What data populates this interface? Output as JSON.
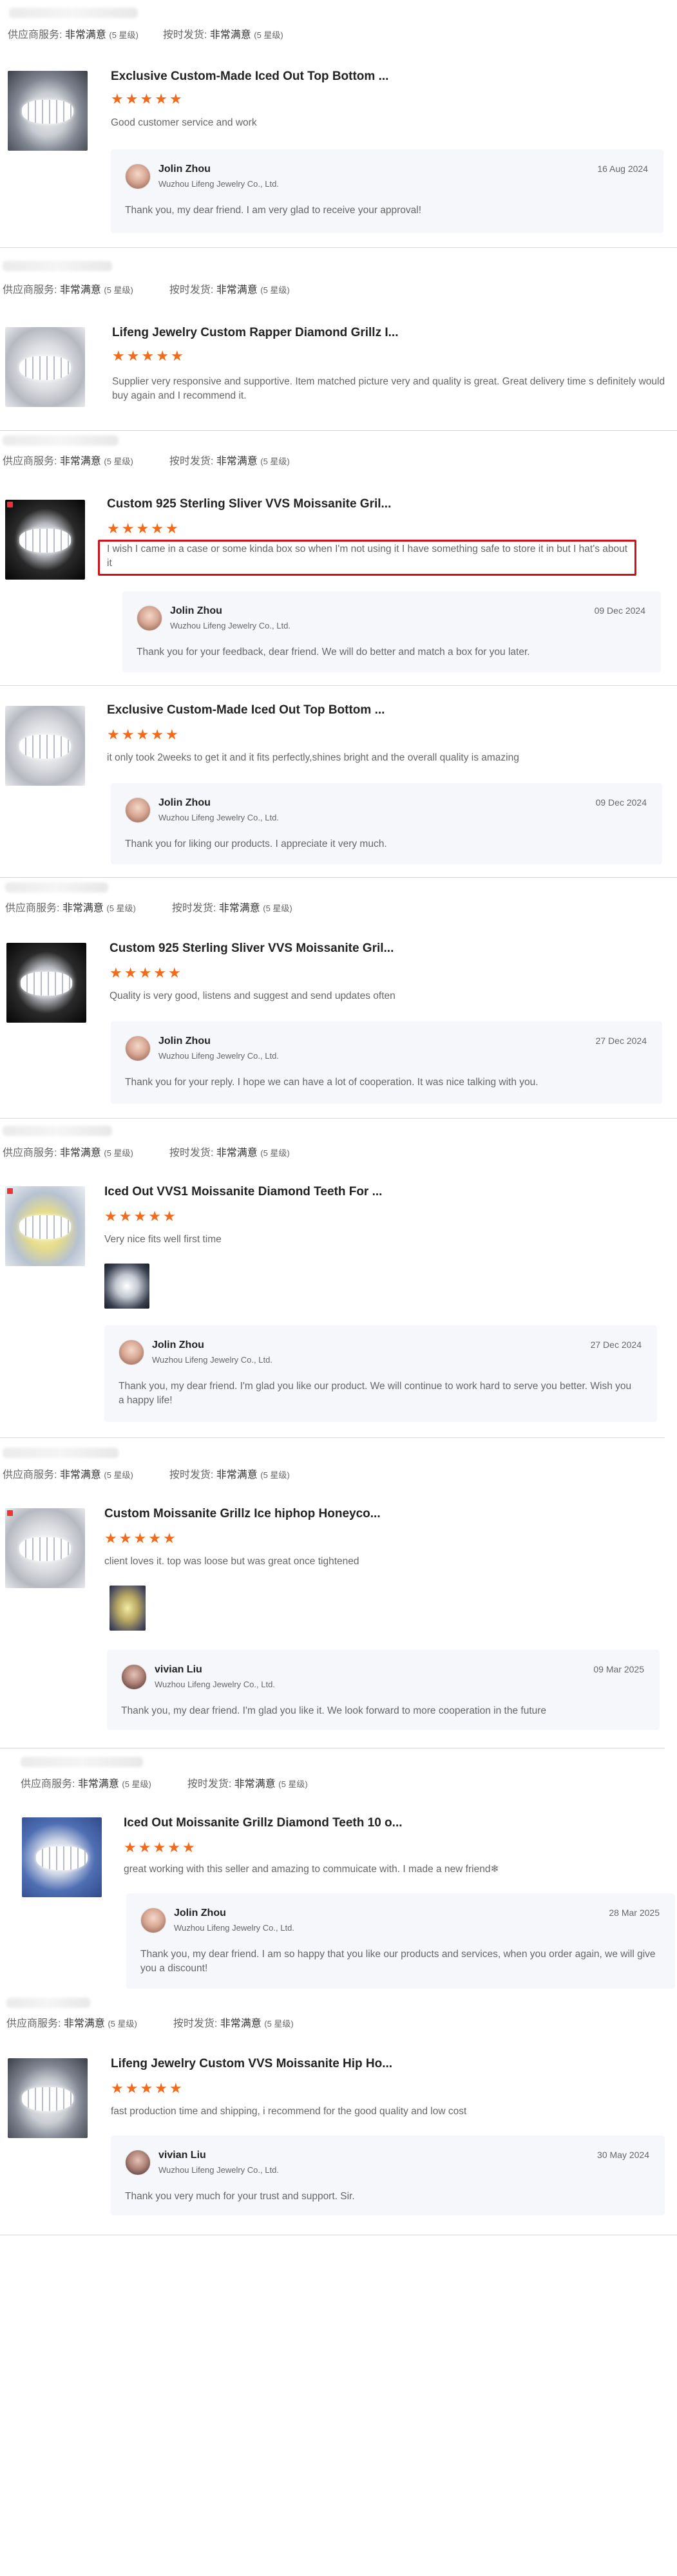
{
  "labels": {
    "supplier_service": "供应商服务:",
    "on_time": "按时发货:",
    "very_satisfied": "非常满意",
    "stars_count": "(5 星级)",
    "star_glyph": "★"
  },
  "reviews": [
    {
      "product_title": "Exclusive Custom-Made Iced Out Top Bottom ...",
      "rating": 5,
      "comment": "Good customer service and work",
      "reply": {
        "name": "Jolin Zhou",
        "company": "Wuzhou Lifeng Jewelry Co., Ltd.",
        "date": "16 Aug 2024",
        "text": "Thank you, my dear friend. I am very glad to receive your approval!"
      }
    },
    {
      "product_title": "Lifeng Jewelry Custom Rapper Diamond Grillz I...",
      "rating": 5,
      "comment": "Supplier very responsive and supportive. Item matched picture very and quality is great. Great delivery time s definitely would buy again and I recommend it."
    },
    {
      "product_title": "Custom 925 Sterling Sliver VVS Moissanite Gril...",
      "rating": 5,
      "comment": "I wish I came in a case or some kinda box so when I'm not using it I have something safe to store it in but I hat's about it",
      "reply": {
        "name": "Jolin Zhou",
        "company": "Wuzhou Lifeng Jewelry Co., Ltd.",
        "date": "09 Dec 2024",
        "text": "Thank you for your feedback, dear friend. We will do better and match a box for you later."
      }
    },
    {
      "product_title": "Exclusive Custom-Made Iced Out Top Bottom ...",
      "rating": 5,
      "comment": "it only took 2weeks to get it and it fits perfectly,shines bright and the overall quality is amazing",
      "reply": {
        "name": "Jolin Zhou",
        "company": "Wuzhou Lifeng Jewelry Co., Ltd.",
        "date": "09 Dec 2024",
        "text": "Thank you for liking our products. I appreciate it very much."
      }
    },
    {
      "product_title": "Custom 925 Sterling Sliver VVS Moissanite Gril...",
      "rating": 5,
      "comment": "Quality is very good, listens and suggest and send updates often",
      "reply": {
        "name": "Jolin Zhou",
        "company": "Wuzhou Lifeng Jewelry Co., Ltd.",
        "date": "27 Dec 2024",
        "text": "Thank you for your reply. I hope we can have a lot of cooperation. It was nice talking with you."
      }
    },
    {
      "product_title": "Iced Out VVS1 Moissanite Diamond Teeth For ...",
      "rating": 5,
      "comment": "Very nice fits well first time",
      "reply": {
        "name": "Jolin Zhou",
        "company": "Wuzhou Lifeng Jewelry Co., Ltd.",
        "date": "27 Dec 2024",
        "text": "Thank you, my dear friend. I'm glad you like our product. We will continue to work hard to serve you better. Wish you a happy life!"
      }
    },
    {
      "product_title": "Custom Moissanite Grillz Ice hiphop Honeyco...",
      "rating": 5,
      "comment": "client loves it. top was loose but was great once tightened",
      "reply": {
        "name": "vivian Liu",
        "company": "Wuzhou Lifeng Jewelry Co., Ltd.",
        "date": "09 Mar 2025",
        "text": "Thank you, my dear friend. I'm glad you like it. We look forward to more cooperation in the future"
      }
    },
    {
      "product_title": "Iced Out Moissanite Grillz Diamond Teeth 10 o...",
      "rating": 5,
      "comment": "great working with this seller and amazing to commuicate with. I made a new friend❄",
      "reply": {
        "name": "Jolin Zhou",
        "company": "Wuzhou Lifeng Jewelry Co., Ltd.",
        "date": "28 Mar 2025",
        "text": "Thank you, my dear friend. I am so happy that you like our products and services, when you order again, we will give you a discount!"
      }
    },
    {
      "product_title": "Lifeng Jewelry Custom VVS Moissanite Hip Ho...",
      "rating": 5,
      "comment": "fast production time and shipping, i recommend for the good quality and low cost",
      "reply": {
        "name": "vivian Liu",
        "company": "Wuzhou Lifeng Jewelry Co., Ltd.",
        "date": "30 May 2024",
        "text": "Thank you very much for your trust and support. Sir."
      }
    }
  ]
}
